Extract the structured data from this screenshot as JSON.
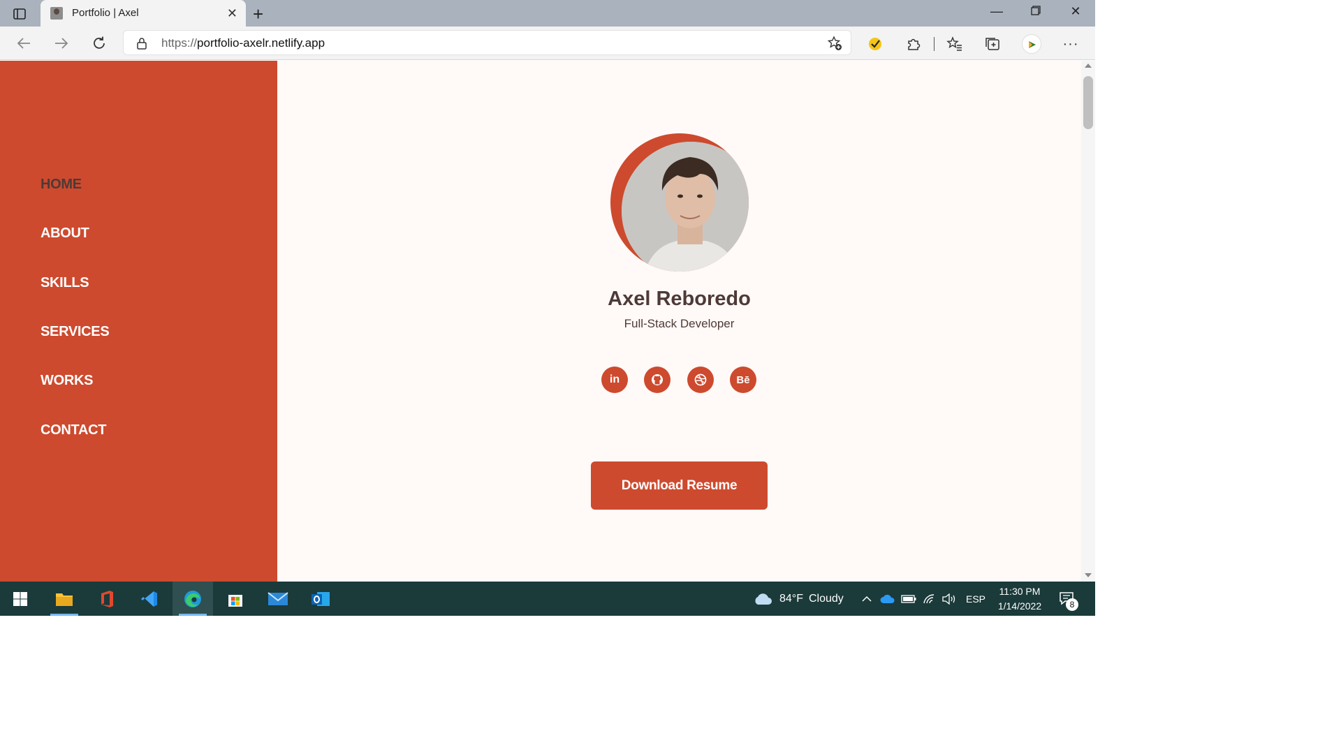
{
  "browser": {
    "tab_title": "Portfolio | Axel",
    "url_protocol": "https://",
    "url_host": "portfolio-axelr.netlify.app"
  },
  "sidebar": {
    "items": [
      {
        "label": "HOME",
        "active": true
      },
      {
        "label": "ABOUT",
        "active": false
      },
      {
        "label": "SKILLS",
        "active": false
      },
      {
        "label": "SERVICES",
        "active": false
      },
      {
        "label": "WORKS",
        "active": false
      },
      {
        "label": "CONTACT",
        "active": false
      }
    ]
  },
  "profile": {
    "name": "Axel Reboredo",
    "role": "Full-Stack Developer",
    "socials": [
      {
        "icon": "linkedin-icon",
        "glyph": "in"
      },
      {
        "icon": "github-icon",
        "glyph": ""
      },
      {
        "icon": "dribbble-icon",
        "glyph": ""
      },
      {
        "icon": "behance-icon",
        "glyph": "Bē"
      }
    ],
    "cta_label": "Download Resume"
  },
  "taskbar": {
    "weather_temp": "84°F",
    "weather_text": "Cloudy",
    "language": "ESP",
    "time": "11:30 PM",
    "date": "1/14/2022",
    "notification_count": "8"
  },
  "colors": {
    "accent": "#cd4a2e",
    "text_dark": "#4d3a36",
    "page_bg": "#fff9f7",
    "taskbar_bg": "#1b3a3a"
  }
}
